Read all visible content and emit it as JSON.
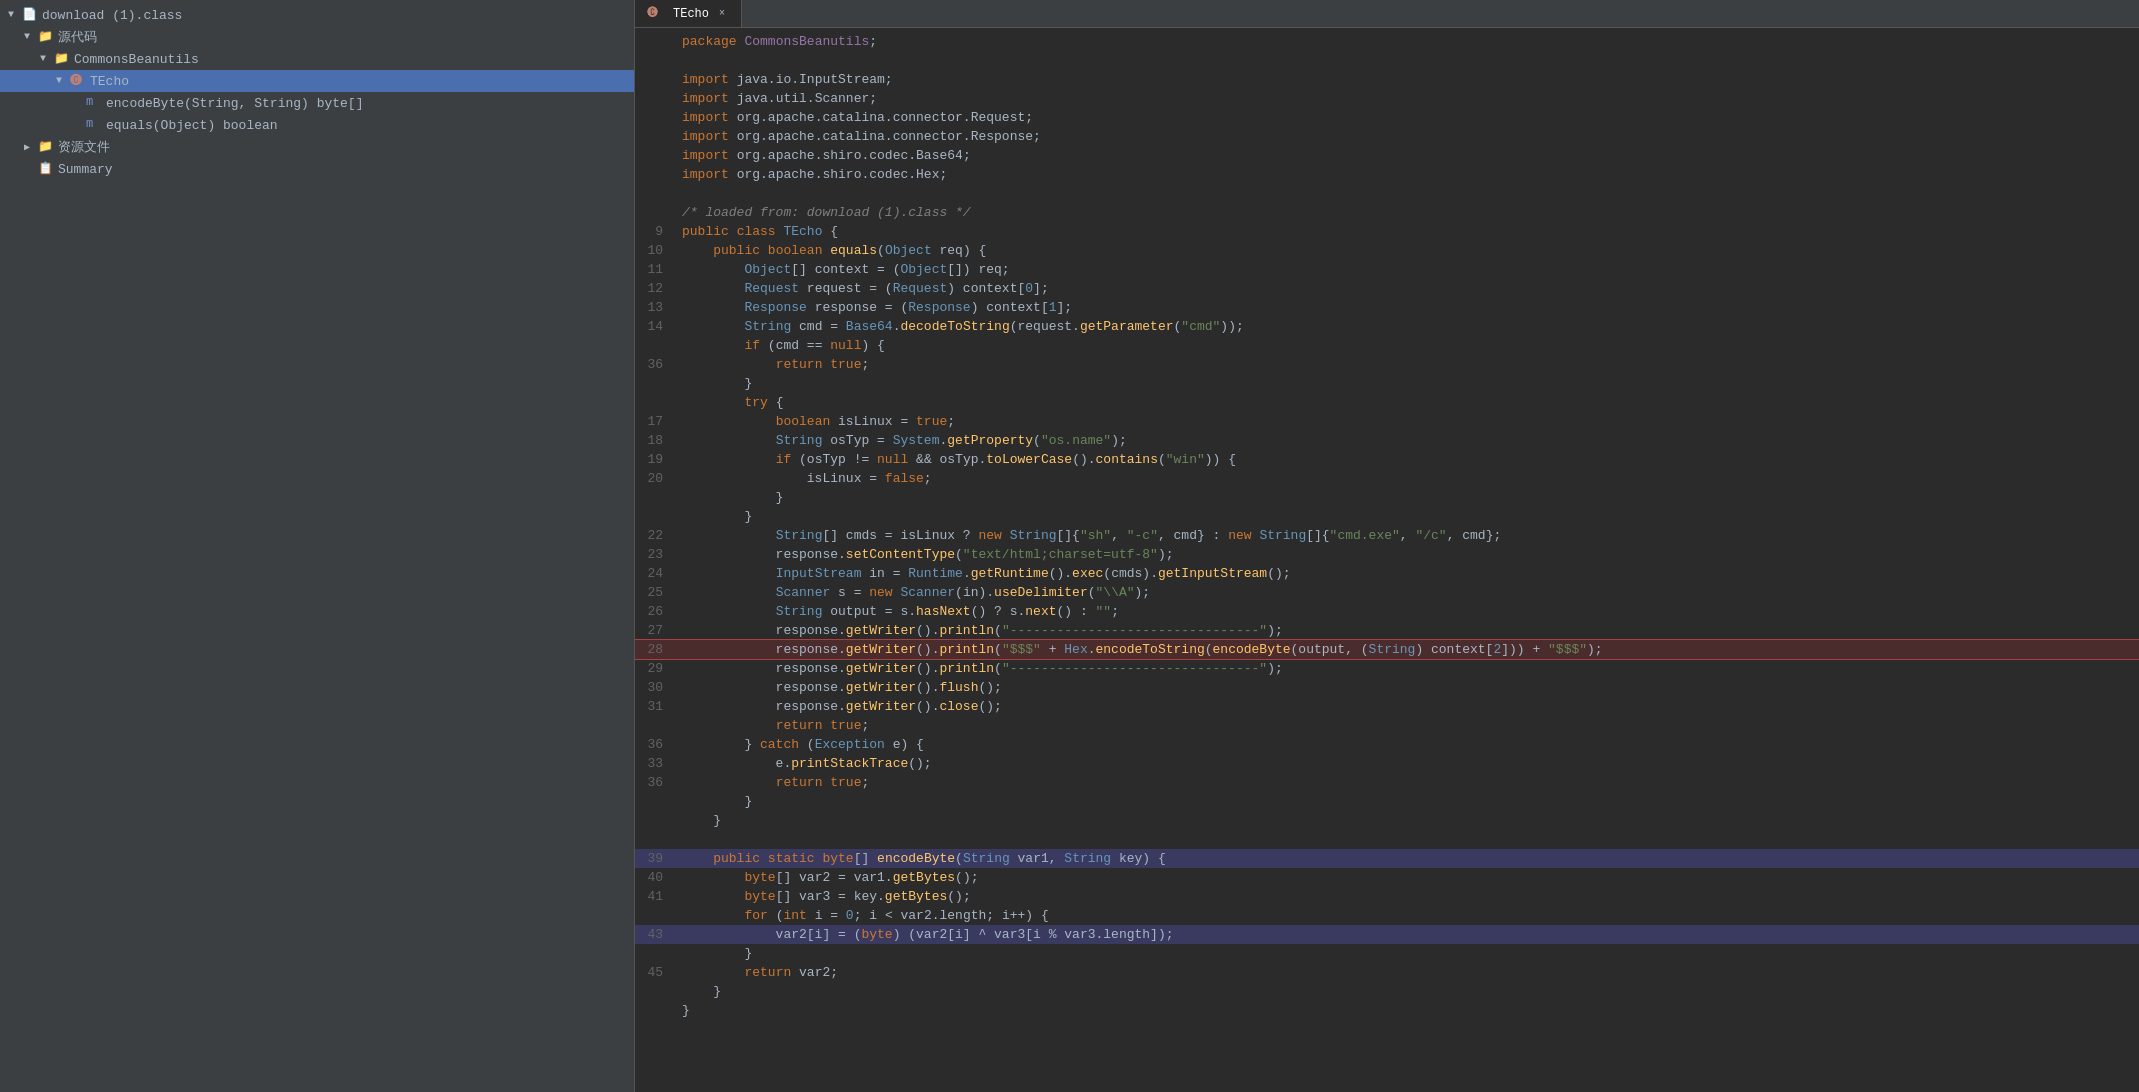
{
  "leftPanel": {
    "title": "download (1).class",
    "tree": [
      {
        "id": "root",
        "label": "download (1).class",
        "indent": 0,
        "type": "file",
        "arrow": "down"
      },
      {
        "id": "source",
        "label": "源代码",
        "indent": 1,
        "type": "folder",
        "arrow": "down"
      },
      {
        "id": "commonsbeanutils",
        "label": "CommonsBeanutils",
        "indent": 2,
        "type": "folder",
        "arrow": "down"
      },
      {
        "id": "techo",
        "label": "TEcho",
        "indent": 3,
        "type": "class",
        "arrow": "down",
        "selected": true
      },
      {
        "id": "encodebyte",
        "label": "encodeByte(String, String) byte[]",
        "indent": 4,
        "type": "method"
      },
      {
        "id": "equals",
        "label": "equals(Object) boolean",
        "indent": 4,
        "type": "method"
      },
      {
        "id": "resources",
        "label": "资源文件",
        "indent": 1,
        "type": "folder",
        "arrow": "right"
      },
      {
        "id": "summary",
        "label": "Summary",
        "indent": 1,
        "type": "summary"
      }
    ]
  },
  "editor": {
    "tab": {
      "label": "TEcho",
      "icon": "class-icon",
      "close": "×"
    },
    "packageLine": "package CommonsBeanutils;",
    "imports": [
      "import java.io.InputStream;",
      "import java.util.Scanner;",
      "import org.apache.catalina.connector.Request;",
      "import org.apache.catalina.connector.Response;",
      "import org.apache.shiro.codec.Base64;",
      "import org.apache.shiro.codec.Hex;"
    ]
  },
  "colors": {
    "background": "#2b2b2b",
    "leftPanel": "#3c3f41",
    "selected": "#4b6eaf",
    "tabActive": "#2b2b2b",
    "tabInactive": "#4e5254",
    "lineHighlightRed": "#ff5555",
    "highlightedLine": "#3a3a60"
  }
}
